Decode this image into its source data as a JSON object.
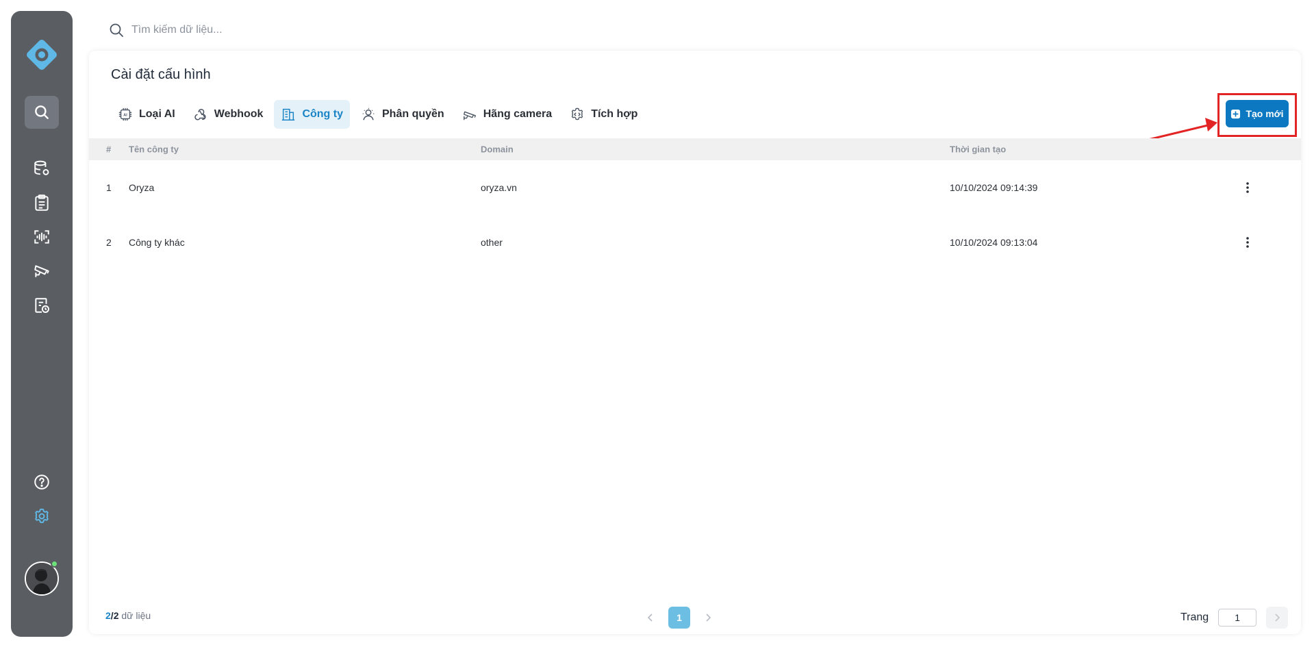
{
  "search": {
    "placeholder": "Tìm kiếm dữ liệu..."
  },
  "sidebar": {
    "logo_icon": "oryza-logo-icon",
    "items": [
      {
        "icon": "search-icon",
        "active": true
      },
      {
        "icon": "database-settings-icon"
      },
      {
        "icon": "clipboard-list-icon"
      },
      {
        "icon": "face-scan-icon"
      },
      {
        "icon": "cctv-camera-icon"
      },
      {
        "icon": "report-clock-icon"
      },
      {
        "icon": "help-circle-icon"
      },
      {
        "icon": "settings-gear-icon",
        "accent": "#5fb8e6"
      }
    ]
  },
  "page": {
    "title": "Cài đặt cấu hình"
  },
  "tabs": [
    {
      "label": "Loại AI",
      "icon": "ai-chip-icon"
    },
    {
      "label": "Webhook",
      "icon": "webhook-icon"
    },
    {
      "label": "Công ty",
      "icon": "building-icon",
      "active": true
    },
    {
      "label": "Phân quyền",
      "icon": "user-permission-icon"
    },
    {
      "label": "Hãng camera",
      "icon": "camera-icon"
    },
    {
      "label": "Tích hợp",
      "icon": "integration-gear-icon"
    }
  ],
  "create_button": {
    "label": "Tạo mới",
    "icon": "plus-square-icon"
  },
  "table": {
    "headers": {
      "index": "#",
      "name": "Tên công ty",
      "domain": "Domain",
      "created": "Thời gian tạo"
    },
    "rows": [
      {
        "index": "1",
        "name": "Oryza",
        "domain": "oryza.vn",
        "created": "10/10/2024 09:14:39"
      },
      {
        "index": "2",
        "name": "Công ty khác",
        "domain": "other",
        "created": "10/10/2024 09:13:04"
      }
    ]
  },
  "footer": {
    "shown": "2",
    "separator": "/",
    "total": "2",
    "suffix": "dữ liệu",
    "current_page": "1",
    "page_label": "Trang",
    "page_input": "1"
  },
  "colors": {
    "primary": "#0d78c2",
    "accent": "#1a84c7",
    "sidebar": "#5a5e63",
    "annotation": "#e32424"
  }
}
